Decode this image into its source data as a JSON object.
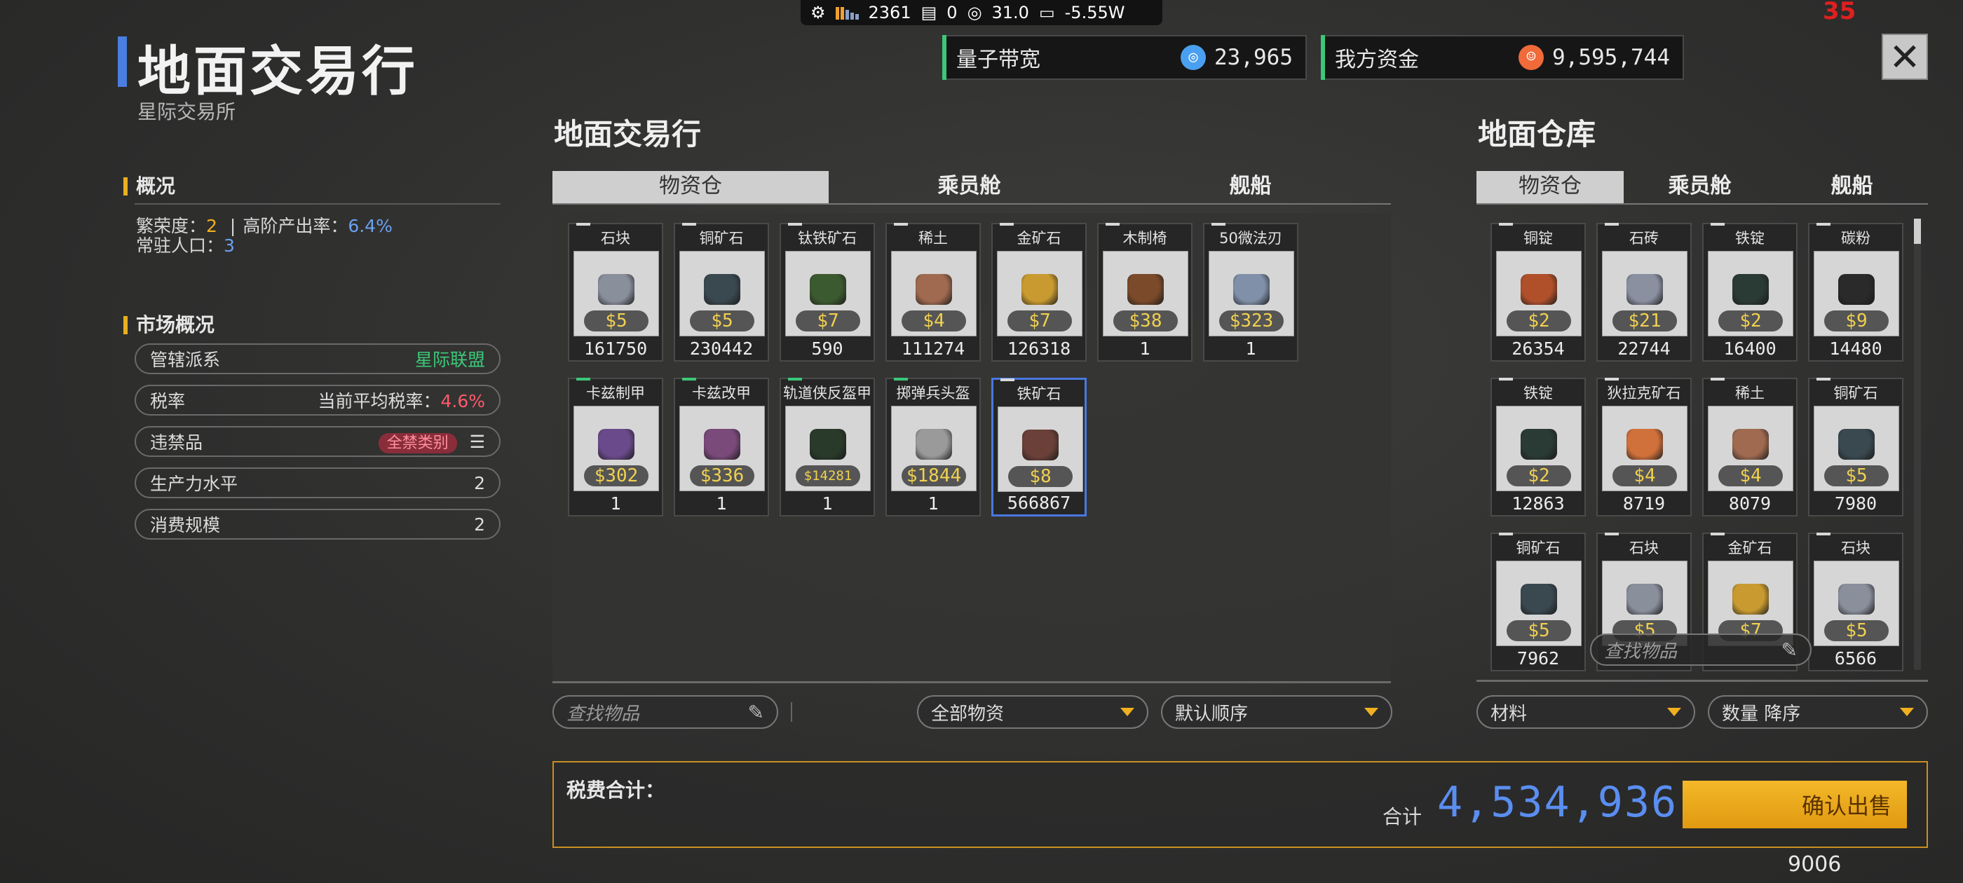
{
  "status_bar": {
    "cpu": "2361",
    "mem": "0",
    "volt": "31.0",
    "power": "-5.55W"
  },
  "fps": "35",
  "title": "地面交易行",
  "subtitle": "星际交易所",
  "overview": {
    "heading": "概况",
    "prosperity_label": "繁荣度：",
    "prosperity": "2",
    "sep": "|",
    "output_label": "高阶产出率：",
    "output": "6.4%",
    "pop_label": "常驻人口：",
    "pop": "3"
  },
  "market": {
    "heading": "市场概况",
    "faction_label": "管辖派系",
    "faction": "星际联盟",
    "tax_label": "税率",
    "tax_text": "当前平均税率：",
    "tax": "4.6%",
    "contraband_label": "违禁品",
    "contraband": "全禁类别",
    "productivity_label": "生产力水平",
    "productivity": "2",
    "consumption_label": "消费规模",
    "consumption": "2"
  },
  "resources": {
    "bandwidth_label": "量子带宽",
    "bandwidth": "23,965",
    "funds_label": "我方资金",
    "funds": "9,595,744"
  },
  "left_panel": {
    "title": "地面交易行",
    "tabs": [
      "物资仓",
      "乘员舱",
      "舰船"
    ],
    "items": [
      {
        "name": "石块",
        "price": "$5",
        "count": "161750",
        "color": "#8a8f9c"
      },
      {
        "name": "铜矿石",
        "price": "$5",
        "count": "230442",
        "color": "#3a4850"
      },
      {
        "name": "钛铁矿石",
        "price": "$7",
        "count": "590",
        "color": "#3c5a30"
      },
      {
        "name": "稀土",
        "price": "$4",
        "count": "111274",
        "color": "#a06a50"
      },
      {
        "name": "金矿石",
        "price": "$7",
        "count": "126318",
        "color": "#c89a30"
      },
      {
        "name": "木制椅",
        "price": "$38",
        "count": "1",
        "color": "#7a4a2a"
      },
      {
        "name": "50微法刃",
        "price": "$323",
        "count": "1",
        "color": "#8090a8"
      },
      {
        "name": "卡兹制甲",
        "price": "$302",
        "count": "1",
        "color": "#6a4a8a"
      },
      {
        "name": "卡兹改甲",
        "price": "$336",
        "count": "1",
        "color": "#7a4a7a"
      },
      {
        "name": "轨道侠反盔甲",
        "price": "$14281",
        "count": "1",
        "color": "#2a3a2a"
      },
      {
        "name": "掷弹兵头盔",
        "price": "$1844",
        "count": "1",
        "color": "#9a9a9a"
      },
      {
        "name": "铁矿石",
        "price": "$8",
        "count": "566867",
        "color": "#6a4038"
      }
    ],
    "search_placeholder": "查找物品",
    "filter": "全部物资",
    "sort": "默认顺序"
  },
  "right_panel": {
    "title": "地面仓库",
    "tabs": [
      "物资仓",
      "乘员舱",
      "舰船"
    ],
    "items": [
      {
        "name": "铜锭",
        "price": "$2",
        "count": "26354",
        "color": "#b0502a"
      },
      {
        "name": "石砖",
        "price": "$21",
        "count": "22744",
        "color": "#8a90a0"
      },
      {
        "name": "铁锭",
        "price": "$2",
        "count": "16400",
        "color": "#2a3a34"
      },
      {
        "name": "碳粉",
        "price": "$9",
        "count": "14480",
        "color": "#2a2a2a"
      },
      {
        "name": "铁锭",
        "price": "$2",
        "count": "12863",
        "color": "#2a3a34"
      },
      {
        "name": "狄拉克矿石",
        "price": "$4",
        "count": "8719",
        "color": "#d0703a"
      },
      {
        "name": "稀土",
        "price": "$4",
        "count": "8079",
        "color": "#a06a50"
      },
      {
        "name": "铜矿石",
        "price": "$5",
        "count": "7980",
        "color": "#3a4850"
      },
      {
        "name": "铜矿石",
        "price": "$5",
        "count": "7962",
        "color": "#3a4850"
      },
      {
        "name": "石块",
        "price": "$5",
        "count": "",
        "color": "#8a8f9c"
      },
      {
        "name": "金矿石",
        "price": "$7",
        "count": "",
        "color": "#c89a30"
      },
      {
        "name": "石块",
        "price": "$5",
        "count": "6566",
        "color": "#8a8f9c"
      }
    ],
    "search_placeholder": "查找物品",
    "filter": "材料",
    "sort": "数量 降序"
  },
  "tax_summary": {
    "label": "税费合计：",
    "total_label": "合计",
    "total": "4,534,936",
    "confirm": "确认出售"
  },
  "footer_number": "9006"
}
